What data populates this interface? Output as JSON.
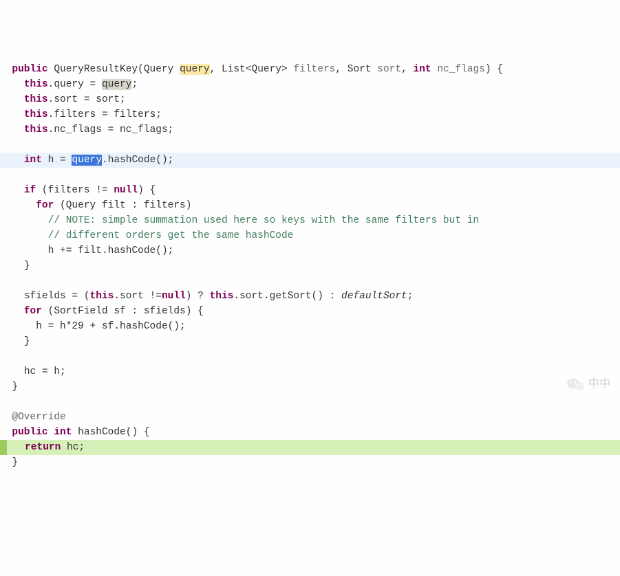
{
  "code": {
    "l1_public": "public",
    "l1_methodname": "QueryResultKey",
    "l1_type_query": "Query",
    "l1_param_query": "query",
    "l1_list": "List",
    "l1_langle": "<",
    "l1_query2": "Query",
    "l1_rangle": ">",
    "l1_param_filters": "filters",
    "l1_sort": "Sort",
    "l1_param_sort": "sort",
    "l1_int": "int",
    "l1_param_nc": "nc_flags",
    "l2_this": "this",
    "l2_field": "query",
    "l2_eq": " = ",
    "l2_var": "query",
    "l3_this": "this",
    "l3_field": "sort",
    "l3_eq": " = sort;",
    "l4_this": "this",
    "l4_field": "filters",
    "l4_eq": " = filters;",
    "l5_this": "this",
    "l5_field": "nc_flags",
    "l5_eq": " = nc_flags;",
    "l7_int": "int",
    "l7_h": " h = ",
    "l7_query": "query",
    "l7_hash": ".hashCode();",
    "l9_if": "if",
    "l9_cond_open": " (filters != ",
    "l9_null": "null",
    "l9_cond_close": ") {",
    "l10_for": "for",
    "l10_rest": " (Query filt : filters)",
    "l11_comment": "// NOTE: simple summation used here so keys with the same filters but in",
    "l12_comment": "// different orders get the same hashCode",
    "l13": "h += filt.hashCode();",
    "l14": "}",
    "l16_sfields": "sfields = (",
    "l16_this1": "this",
    "l16_sort1": ".sort !=",
    "l16_null": "null",
    "l16_q": ") ? ",
    "l16_this2": "this",
    "l16_getsort": ".sort.getSort() : ",
    "l16_default": "defaultSort",
    "l16_semi": ";",
    "l17_for": "for",
    "l17_rest": " (SortField sf : sfields) {",
    "l18": "h = h*29 + sf.hashCode();",
    "l19": "}",
    "l21": "hc = h;",
    "l22": "}",
    "l24_anno": "@Override",
    "l25_public": "public",
    "l25_int": "int",
    "l25_rest": " hashCode() {",
    "l26_return": "return",
    "l26_hc": " hc;",
    "l27": "}"
  },
  "watermark": "中中"
}
